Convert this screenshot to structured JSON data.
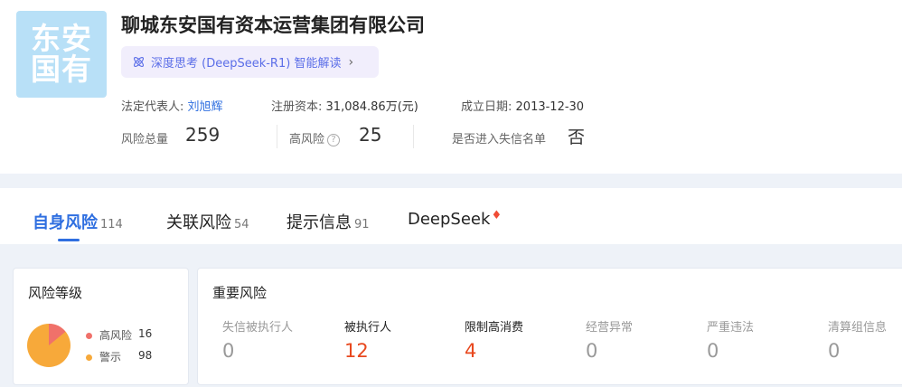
{
  "company": {
    "logo_line1": "东安",
    "logo_line2": "国有",
    "name": "聊城东安国有资本运营集团有限公司"
  },
  "ai_button": {
    "label": "深度思考 (DeepSeek-R1) 智能解读",
    "chevron": "›"
  },
  "meta": {
    "legal_rep_label": "法定代表人:",
    "legal_rep_value": "刘旭辉",
    "capital_label": "注册资本:",
    "capital_value": "31,084.86万(元)",
    "founded_label": "成立日期:",
    "founded_value": "2013-12-30"
  },
  "stats": {
    "total_label": "风险总量",
    "total_value": "259",
    "high_label": "高风险",
    "high_value": "25",
    "blacklist_label": "是否进入失信名单",
    "blacklist_value": "否",
    "help_glyph": "?"
  },
  "tabs": [
    {
      "label": "自身风险",
      "count": "114"
    },
    {
      "label": "关联风险",
      "count": "54"
    },
    {
      "label": "提示信息",
      "count": "91"
    },
    {
      "label": "DeepSeek",
      "count": ""
    }
  ],
  "risk_level": {
    "title": "风险等级",
    "high_label": "高风险",
    "high_value": 16,
    "warn_label": "警示",
    "warn_value": 98,
    "high_color": "#f0716a",
    "warn_color": "#f7a93a"
  },
  "important": {
    "title": "重要风险",
    "items": [
      {
        "label": "失信被执行人",
        "value": "0"
      },
      {
        "label": "被执行人",
        "value": "12"
      },
      {
        "label": "限制高消费",
        "value": "4"
      },
      {
        "label": "经营异常",
        "value": "0"
      },
      {
        "label": "严重违法",
        "value": "0"
      },
      {
        "label": "清算组信息",
        "value": "0"
      }
    ]
  }
}
